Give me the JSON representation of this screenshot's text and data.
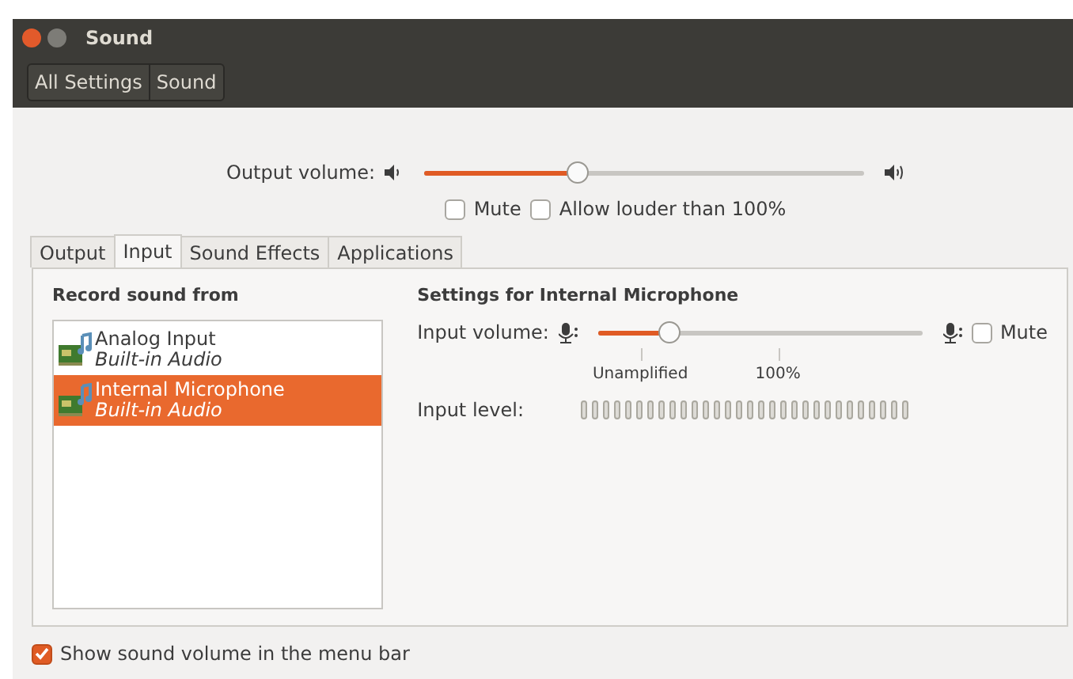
{
  "window": {
    "title": "Sound"
  },
  "breadcrumbs": [
    {
      "label": "All Settings"
    },
    {
      "label": "Sound"
    }
  ],
  "output_volume": {
    "label": "Output volume:",
    "level": 0.35
  },
  "output_options": [
    {
      "label": "Mute",
      "checked": false
    },
    {
      "label": "Allow louder than 100%",
      "checked": false
    }
  ],
  "tabs": [
    {
      "label": "Output",
      "selected": false
    },
    {
      "label": "Input",
      "selected": true
    },
    {
      "label": "Sound Effects",
      "selected": false
    },
    {
      "label": "Applications",
      "selected": false
    }
  ],
  "record_from": {
    "heading": "Record sound from",
    "devices": [
      {
        "name": "Analog Input",
        "description": "Built-in Audio",
        "selected": false
      },
      {
        "name": "Internal Microphone",
        "description": "Built-in Audio",
        "selected": true
      }
    ]
  },
  "settings": {
    "heading": "Settings for Internal Microphone",
    "input_volume": {
      "label": "Input volume:",
      "level": 0.22,
      "mute": {
        "label": "Mute",
        "checked": false
      },
      "marks": [
        "Unamplified",
        "100%"
      ]
    },
    "input_level": {
      "label": "Input level:"
    }
  },
  "footer": {
    "label": "Show sound volume in the menu bar",
    "checked": true
  }
}
